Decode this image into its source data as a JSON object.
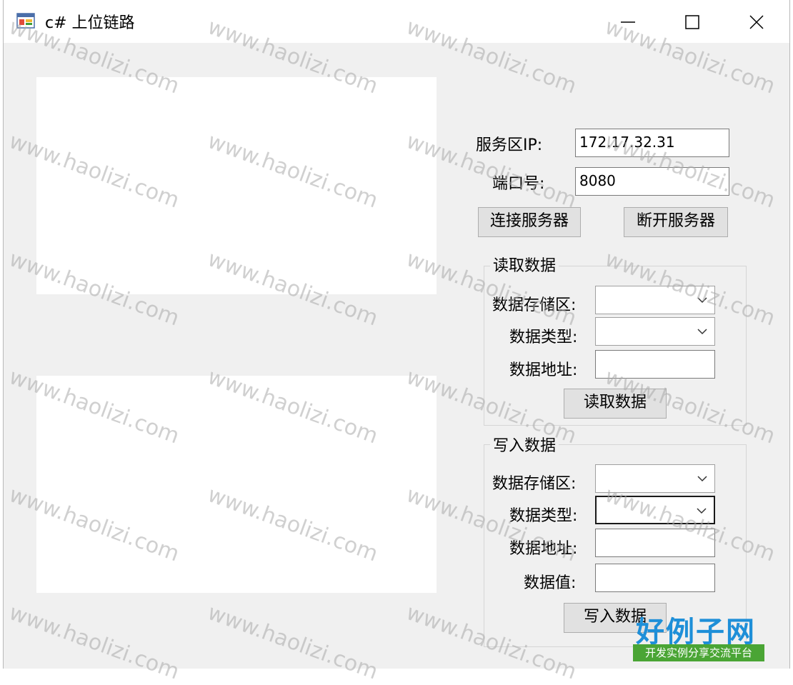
{
  "window": {
    "title": "c# 上位链路",
    "controls": {
      "minimize": "minimize-icon",
      "maximize": "maximize-icon",
      "close": "close-icon"
    }
  },
  "connection": {
    "server_ip_label": "服务区IP:",
    "server_ip_value": "172.17.32.31",
    "port_label": "端口号:",
    "port_value": "8080",
    "connect_button": "连接服务器",
    "disconnect_button": "断开服务器"
  },
  "read_group": {
    "title": "读取数据",
    "storage_label": "数据存储区:",
    "storage_value": "",
    "type_label": "数据类型:",
    "type_value": "",
    "address_label": "数据地址:",
    "address_value": "",
    "read_button": "读取数据"
  },
  "write_group": {
    "title": "写入数据",
    "storage_label": "数据存储区:",
    "storage_value": "",
    "type_label": "数据类型:",
    "type_value": "",
    "address_label": "数据地址:",
    "address_value": "",
    "value_label": "数据值:",
    "value_value": "",
    "write_button": "写入数据"
  },
  "watermark": {
    "text": "www.haolizi.com",
    "logo_main": "好例子网",
    "logo_sub": "开发实例分享交流平台"
  },
  "colors": {
    "window_bg": "#f0f0f0",
    "logo_blue": "#1e8fd8",
    "logo_green": "#4aa535"
  }
}
